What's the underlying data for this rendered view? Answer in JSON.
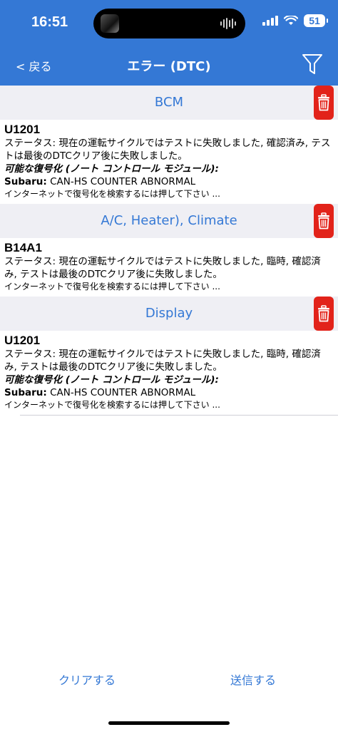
{
  "status_bar": {
    "time": "16:51",
    "battery": "51"
  },
  "nav": {
    "back_label": "< 戻る",
    "title": "エラー (DTC)"
  },
  "sections": [
    {
      "module": "BCM",
      "code": "U1201",
      "status": "ステータス: 現在の運転サイクルではテストに失敗しました, 確認済み, テストは最後のDTCクリア後に失敗しました。",
      "possible_label": "可能な復号化 (ノート コントロール モジュール):",
      "maker": "Subaru:",
      "decoding": "CAN-HS COUNTER ABNORMAL",
      "search_hint": "インターネットで復号化を検索するには押して下さい ..."
    },
    {
      "module": "A/C, Heater), Climate",
      "code": "B14A1",
      "status": "ステータス: 現在の運転サイクルではテストに失敗しました, 臨時, 確認済み, テストは最後のDTCクリア後に失敗しました。",
      "search_hint": "インターネットで復号化を検索するには押して下さい ..."
    },
    {
      "module": "Display",
      "code": "U1201",
      "status": "ステータス: 現在の運転サイクルではテストに失敗しました, 臨時, 確認済み, テストは最後のDTCクリア後に失敗しました。",
      "possible_label": "可能な復号化 (ノート コントロール モジュール):",
      "maker": "Subaru:",
      "decoding": "CAN-HS COUNTER ABNORMAL",
      "search_hint": "インターネットで復号化を検索するには押して下さい ..."
    }
  ],
  "footer": {
    "clear_label": "クリアする",
    "send_label": "送信する"
  },
  "colors": {
    "header_bg": "#3478d5",
    "accent": "#3478d5",
    "delete": "#e2231a",
    "section_bg": "#efeff4"
  },
  "icons": {
    "filter": "filter-funnel-icon",
    "delete": "trash-icon"
  }
}
